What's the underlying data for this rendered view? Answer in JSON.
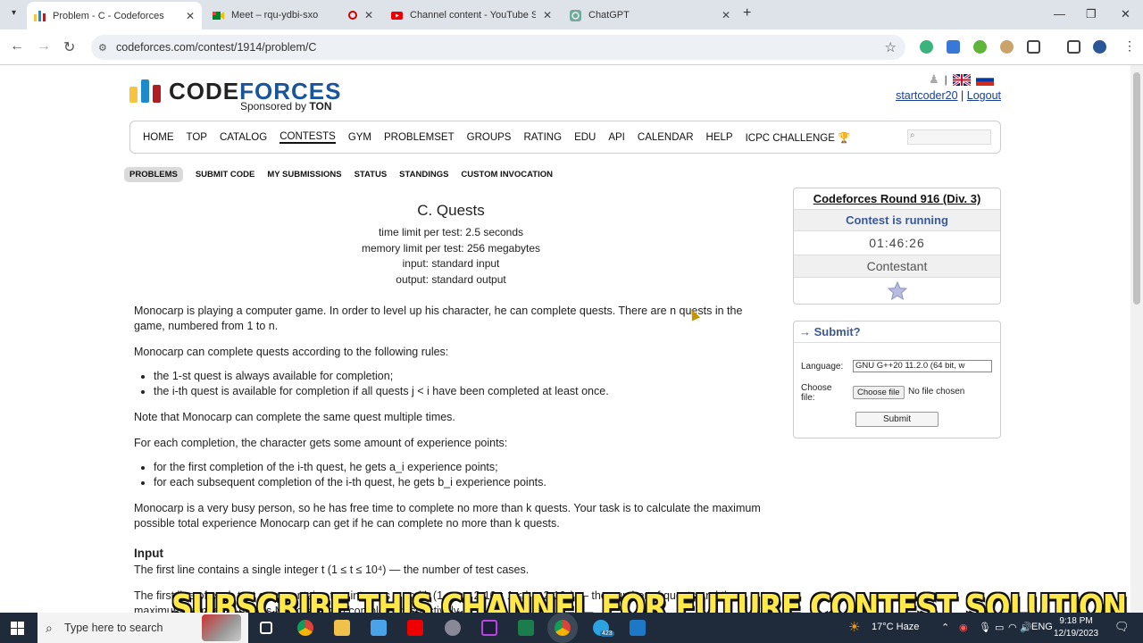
{
  "browser": {
    "tabs": [
      {
        "title": "Problem - C - Codeforces",
        "icon": "codeforces-favicon"
      },
      {
        "title": "Meet – rqu-ydbi-sxo",
        "icon": "meet-favicon"
      },
      {
        "title": "Channel content - YouTube Stu",
        "icon": "youtube-favicon"
      },
      {
        "title": "ChatGPT",
        "icon": "chatgpt-favicon"
      }
    ],
    "url": "codeforces.com/contest/1914/problem/C"
  },
  "site": {
    "logo_a": "CODE",
    "logo_b": "FORCES",
    "sponsored": "Sponsored by",
    "sponsor": "TON",
    "user": "startcoder20",
    "sep": "|",
    "logout": "Logout"
  },
  "menu": [
    "HOME",
    "TOP",
    "CATALOG",
    "CONTESTS",
    "GYM",
    "PROBLEMSET",
    "GROUPS",
    "RATING",
    "EDU",
    "API",
    "CALENDAR",
    "HELP",
    "ICPC CHALLENGE"
  ],
  "subnav": [
    "PROBLEMS",
    "SUBMIT CODE",
    "MY SUBMISSIONS",
    "STATUS",
    "STANDINGS",
    "CUSTOM INVOCATION"
  ],
  "problem": {
    "title": "C. Quests",
    "time_limit": "time limit per test: 2.5 seconds",
    "memory_limit": "memory limit per test: 256 megabytes",
    "input": "input: standard input",
    "output": "output: standard output",
    "p1": "Monocarp is playing a computer game. In order to level up his character, he can complete quests. There are n quests in the game, numbered from 1 to n.",
    "p2": "Monocarp can complete quests according to the following rules:",
    "r1": "the 1-st quest is always available for completion;",
    "r2": "the i-th quest is available for completion if all quests j < i have been completed at least once.",
    "p3": "Note that Monocarp can complete the same quest multiple times.",
    "p4": "For each completion, the character gets some amount of experience points:",
    "e1": "for the first completion of the i-th quest, he gets a_i experience points;",
    "e2": "for each subsequent completion of the i-th quest, he gets b_i experience points.",
    "p5": "Monocarp is a very busy person, so he has free time to complete no more than k quests. Your task is to calculate the maximum possible total experience Monocarp can get if he can complete no more than k quests.",
    "input_head": "Input",
    "input_p1": "The first line contains a single integer t (1 ≤ t ≤ 10⁴) — the number of test cases.",
    "input_p2": "The first line of each test case contains two integers n and k (1 ≤ n ≤ 2·10⁵; 1 ≤ k ≤ 2·10⁵) — the number of quests and the maximum number of quests Monocarp can complete, respectively."
  },
  "sidebar": {
    "round": "Codeforces Round 916 (Div. 3)",
    "status": "Contest is running",
    "timer": "01:46:26",
    "role": "Contestant",
    "submit_head": "→ Submit?",
    "language_label": "Language:",
    "language_value": "GNU G++20 11.2.0 (64 bit, w",
    "file_label": "Choose file:",
    "file_button": "Choose file",
    "no_file": "No file chosen",
    "submit_button": "Submit"
  },
  "overlay_text": "SUBSCRIBE THIS CHANNEL FOR FUTURE CONTEST SOLUTION",
  "taskbar": {
    "search": "Type here to search",
    "weather": "17°C  Haze",
    "lang": "ENG",
    "time": "9:18 PM",
    "date": "12/19/2023",
    "badge": "423"
  }
}
